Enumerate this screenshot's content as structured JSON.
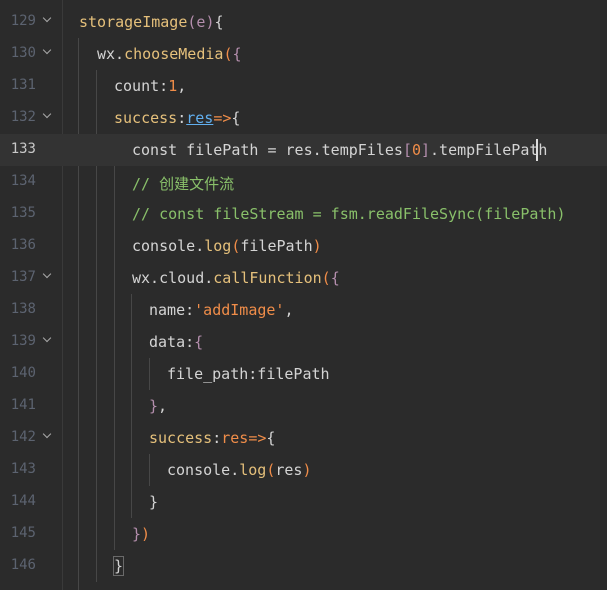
{
  "editor": {
    "lines": [
      {
        "number": "129",
        "code": "storageImage(e){"
      },
      {
        "number": "130",
        "code": "wx.chooseMedia({"
      },
      {
        "number": "131",
        "code": "count:1,"
      },
      {
        "number": "132",
        "code": "success:res=>{"
      },
      {
        "number": "133",
        "code": "const filePath = res.tempFiles[0].tempFilePath"
      },
      {
        "number": "134",
        "code": "// 创建文件流"
      },
      {
        "number": "135",
        "code": "// const fileStream = fsm.readFileSync(filePath)"
      },
      {
        "number": "136",
        "code": "console.log(filePath)"
      },
      {
        "number": "137",
        "code": "wx.cloud.callFunction({"
      },
      {
        "number": "138",
        "code": "name:'addImage',"
      },
      {
        "number": "139",
        "code": "data:{"
      },
      {
        "number": "140",
        "code": "file_path:filePath"
      },
      {
        "number": "141",
        "code": "},"
      },
      {
        "number": "142",
        "code": "success:res=>{"
      },
      {
        "number": "143",
        "code": "console.log(res)"
      },
      {
        "number": "144",
        "code": "}"
      },
      {
        "number": "145",
        "code": "})"
      },
      {
        "number": "146",
        "code": "}"
      }
    ],
    "current_line": "133"
  }
}
